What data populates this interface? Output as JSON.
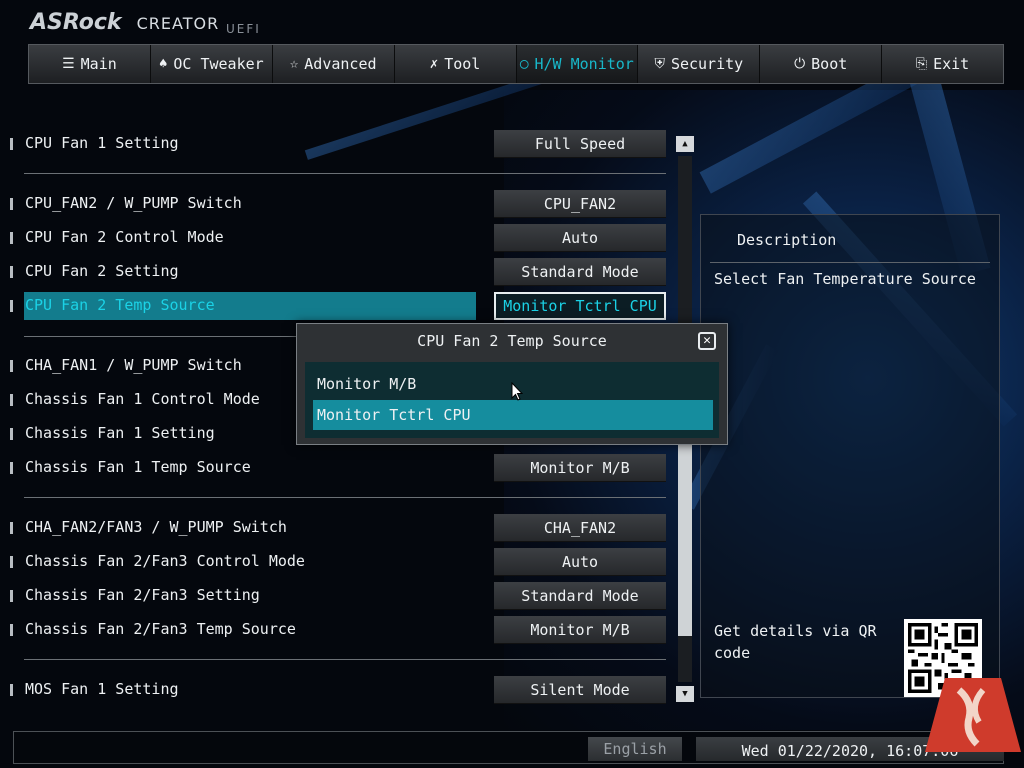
{
  "header": {
    "brand": "ASRock",
    "product": "CREATOR",
    "firmware": "UEFI"
  },
  "tabs": [
    {
      "label": "Main",
      "icon": "list-icon"
    },
    {
      "label": "OC Tweaker",
      "icon": "rocket-icon"
    },
    {
      "label": "Advanced",
      "icon": "star-icon"
    },
    {
      "label": "Tool",
      "icon": "tools-icon"
    },
    {
      "label": "H/W Monitor",
      "icon": "monitor-icon",
      "active": true
    },
    {
      "label": "Security",
      "icon": "shield-icon"
    },
    {
      "label": "Boot",
      "icon": "power-icon"
    },
    {
      "label": "Exit",
      "icon": "exit-icon"
    }
  ],
  "settings": [
    {
      "label": "CPU Fan 1 Setting",
      "value": "Full Speed"
    },
    {
      "label": "CPU_FAN2 / W_PUMP Switch",
      "value": "CPU_FAN2"
    },
    {
      "label": "CPU Fan 2 Control Mode",
      "value": "Auto"
    },
    {
      "label": "CPU Fan 2 Setting",
      "value": "Standard Mode"
    },
    {
      "label": "CPU Fan 2 Temp Source",
      "value": "Monitor Tctrl CPU",
      "selected": true
    },
    {
      "label": "CHA_FAN1 / W_PUMP Switch",
      "value": ""
    },
    {
      "label": "Chassis Fan 1 Control Mode",
      "value": ""
    },
    {
      "label": "Chassis Fan 1 Setting",
      "value": ""
    },
    {
      "label": "Chassis Fan 1 Temp Source",
      "value": "Monitor M/B"
    },
    {
      "label": "CHA_FAN2/FAN3 / W_PUMP Switch",
      "value": "CHA_FAN2"
    },
    {
      "label": "Chassis Fan 2/Fan3 Control Mode",
      "value": "Auto"
    },
    {
      "label": "Chassis Fan 2/Fan3 Setting",
      "value": "Standard Mode"
    },
    {
      "label": "Chassis Fan 2/Fan3 Temp Source",
      "value": "Monitor M/B"
    },
    {
      "label": "MOS Fan 1 Setting",
      "value": "Silent Mode"
    }
  ],
  "description": {
    "title": "Description",
    "text": "Select Fan Temperature Source",
    "qr_text": "Get details via QR code"
  },
  "popup": {
    "title": "CPU Fan 2 Temp Source",
    "close": "✕",
    "options": [
      "Monitor M/B",
      "Monitor Tctrl CPU"
    ],
    "selected_index": 1
  },
  "footer": {
    "language": "English",
    "datetime": "Wed 01/22/2020, 16:07:06"
  },
  "colors": {
    "accent": "#18b7c9",
    "selection": "#137c8d"
  }
}
